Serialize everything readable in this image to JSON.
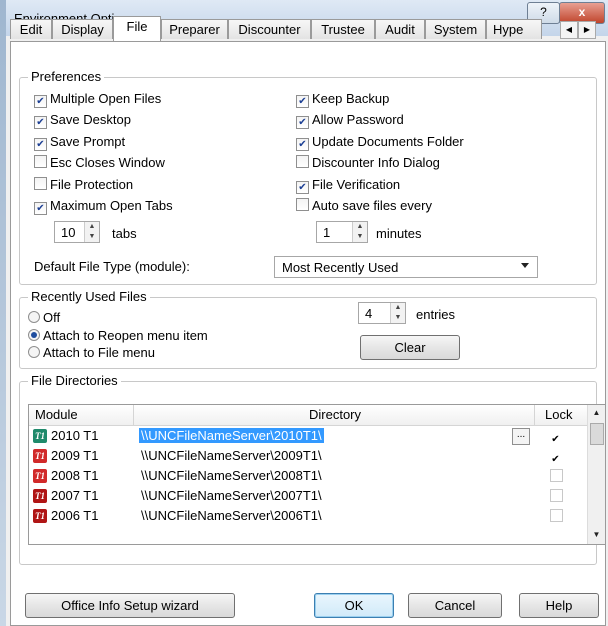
{
  "window": {
    "title": "Environment Options",
    "help_glyph": "?",
    "close_glyph": "x"
  },
  "tabs": [
    "Edit",
    "Display",
    "File",
    "Preparer",
    "Discounter",
    "Trustee",
    "Audit",
    "System",
    "Hype"
  ],
  "active_tab": "File",
  "preferences": {
    "legend": "Preferences",
    "left": [
      {
        "label": "Multiple Open Files",
        "checked": true
      },
      {
        "label": "Save Desktop",
        "checked": true
      },
      {
        "label": "Save Prompt",
        "checked": true
      },
      {
        "label": "Esc Closes Window",
        "checked": false
      },
      {
        "label": "File Protection",
        "checked": false
      },
      {
        "label": "Maximum Open Tabs",
        "checked": true
      }
    ],
    "right": [
      {
        "label": "Keep Backup",
        "checked": true
      },
      {
        "label": "Allow Password",
        "checked": true
      },
      {
        "label": "Update Documents Folder",
        "checked": true
      },
      {
        "label": "Discounter Info Dialog",
        "checked": false
      },
      {
        "label": "File Verification",
        "checked": true
      },
      {
        "label": "Auto save files every",
        "checked": false
      }
    ],
    "tabs_value": "10",
    "tabs_label": "tabs",
    "minutes_value": "1",
    "minutes_label": "minutes",
    "default_type_label": "Default File Type (module):",
    "default_type_value": "Most Recently Used"
  },
  "recent": {
    "legend": "Recently Used Files",
    "options": [
      {
        "label": "Off",
        "selected": false
      },
      {
        "label": "Attach to Reopen menu item",
        "selected": true
      },
      {
        "label": "Attach to File menu",
        "selected": false
      }
    ],
    "entries_value": "4",
    "entries_label": "entries",
    "clear_label": "Clear"
  },
  "directories": {
    "legend": "File Directories",
    "headers": {
      "module": "Module",
      "directory": "Directory",
      "lock": "Lock"
    },
    "icon_text": "T1",
    "rows": [
      {
        "module": "2010 T1",
        "directory": "\\\\UNCFileNameServer\\2010T1\\",
        "lock": true,
        "icon_color": "#1f8a6b"
      },
      {
        "module": "2009 T1",
        "directory": "\\\\UNCFileNameServer\\2009T1\\",
        "lock": true,
        "icon_color": "#d12a2a"
      },
      {
        "module": "2008 T1",
        "directory": "\\\\UNCFileNameServer\\2008T1\\",
        "lock": false,
        "icon_color": "#d12a2a"
      },
      {
        "module": "2007 T1",
        "directory": "\\\\UNCFileNameServer\\2007T1\\",
        "lock": false,
        "icon_color": "#b01515"
      },
      {
        "module": "2006 T1",
        "directory": "\\\\UNCFileNameServer\\2006T1\\",
        "lock": false,
        "icon_color": "#b01515"
      }
    ],
    "ellipsis": "..."
  },
  "buttons": {
    "wizard": "Office Info Setup wizard",
    "ok": "OK",
    "cancel": "Cancel",
    "help": "Help"
  }
}
